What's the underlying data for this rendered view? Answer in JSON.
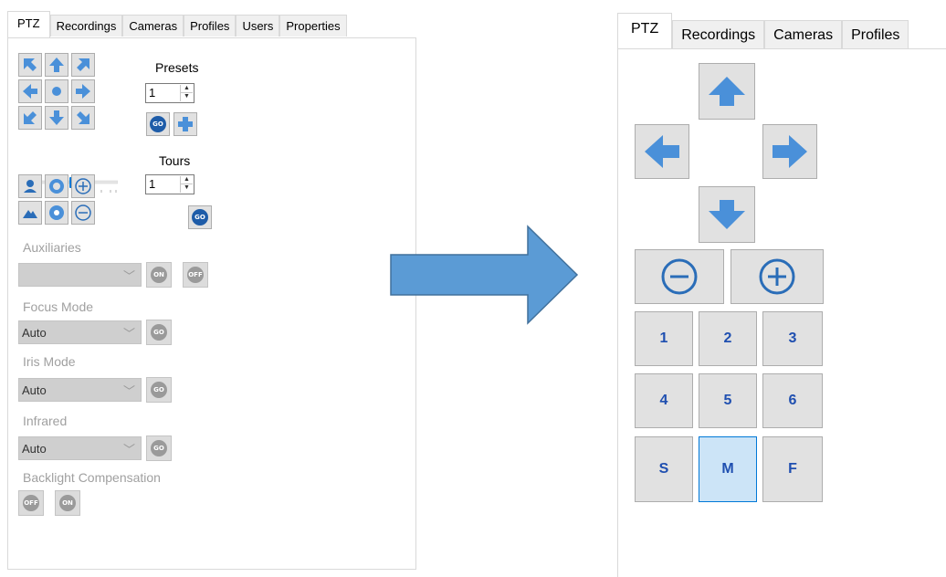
{
  "left_panel": {
    "tabs": [
      {
        "label": "PTZ",
        "active": true
      },
      {
        "label": "Recordings"
      },
      {
        "label": "Cameras"
      },
      {
        "label": "Profiles"
      },
      {
        "label": "Users"
      },
      {
        "label": "Properties"
      }
    ],
    "presets": {
      "label": "Presets",
      "value": "1"
    },
    "tours": {
      "label": "Tours",
      "value": "1"
    },
    "go_label": "GO",
    "on_label": "ON",
    "off_label": "OFF",
    "auxiliaries": {
      "label": "Auxiliaries",
      "value": ""
    },
    "focus_mode": {
      "label": "Focus Mode",
      "value": "Auto"
    },
    "iris_mode": {
      "label": "Iris Mode",
      "value": "Auto"
    },
    "infrared": {
      "label": "Infrared",
      "value": "Auto"
    },
    "backlight": {
      "label": "Backlight Compensation"
    },
    "speed_slider": {
      "value": 0.5
    }
  },
  "right_panel": {
    "tabs": [
      {
        "label": "PTZ",
        "active": true
      },
      {
        "label": "Recordings"
      },
      {
        "label": "Cameras"
      },
      {
        "label": "Profiles"
      }
    ],
    "preset_buttons": [
      "1",
      "2",
      "3",
      "4",
      "5",
      "6",
      "S",
      "M",
      "F"
    ],
    "selected_button": "M"
  },
  "colors": {
    "arrow_blue": "#4a90d9",
    "big_arrow_blue": "#5b9bd5",
    "number_blue": "#1f4fb0",
    "selected_bg": "#cce4f7",
    "selected_border": "#0078d7"
  }
}
